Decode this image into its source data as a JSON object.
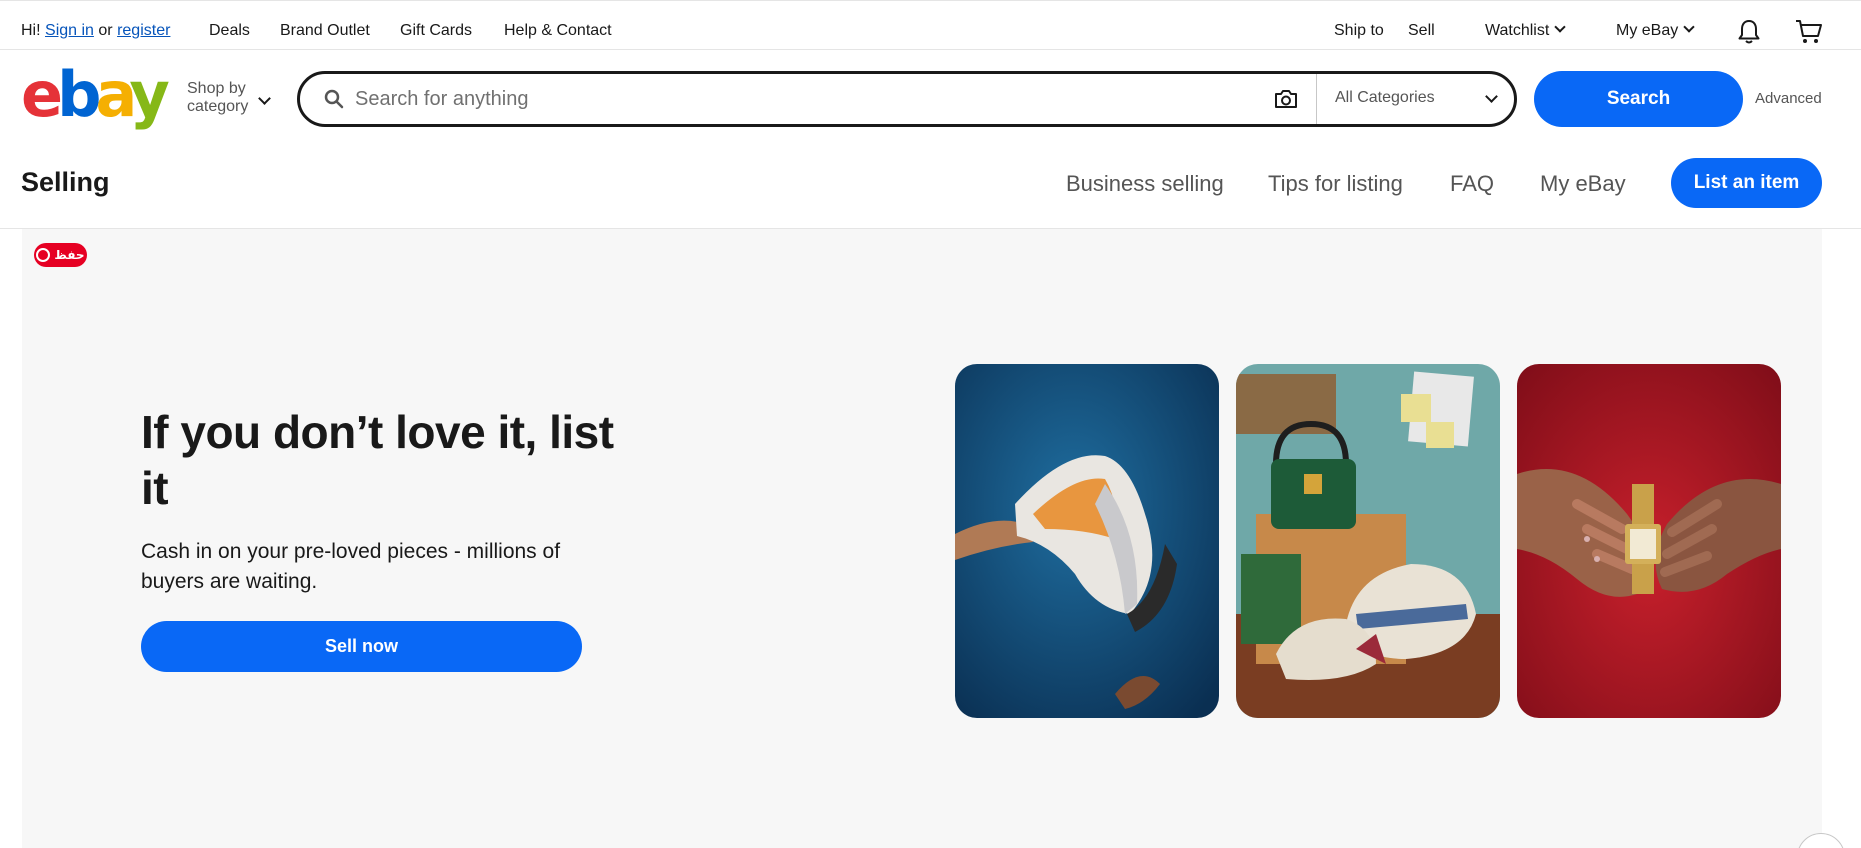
{
  "topbar": {
    "greeting": "Hi!",
    "sign_in": "Sign in",
    "or": "or",
    "register": "register",
    "links": [
      "Deals",
      "Brand Outlet",
      "Gift Cards",
      "Help & Contact"
    ],
    "ship_to": "Ship to",
    "sell": "Sell",
    "watchlist": "Watchlist",
    "my_ebay": "My eBay"
  },
  "header": {
    "logo": {
      "e": "e",
      "b": "b",
      "a": "a",
      "y": "y"
    },
    "shop_by_line1": "Shop by",
    "shop_by_line2": "category",
    "search_placeholder": "Search for anything",
    "category_selected": "All Categories",
    "search_button": "Search",
    "advanced": "Advanced"
  },
  "selling_nav": {
    "title": "Selling",
    "links": [
      "Business selling",
      "Tips for listing",
      "FAQ",
      "My eBay"
    ],
    "list_button": "List an item"
  },
  "hero": {
    "pinterest_label": "حفظ",
    "headline": "If you don’t love it, list it",
    "subtext": "Cash in on your pre-loved pieces - millions of buyers are waiting.",
    "sell_button": "Sell now"
  },
  "icons": {
    "search": "search-icon",
    "camera": "camera-icon",
    "bell": "bell-icon",
    "cart": "cart-icon"
  },
  "colors": {
    "accent_blue": "#0968f6",
    "logo_red": "#e53238",
    "logo_blue": "#0064d2",
    "logo_yellow": "#f5af02",
    "logo_green": "#86b817",
    "pinterest_red": "#e60023"
  }
}
